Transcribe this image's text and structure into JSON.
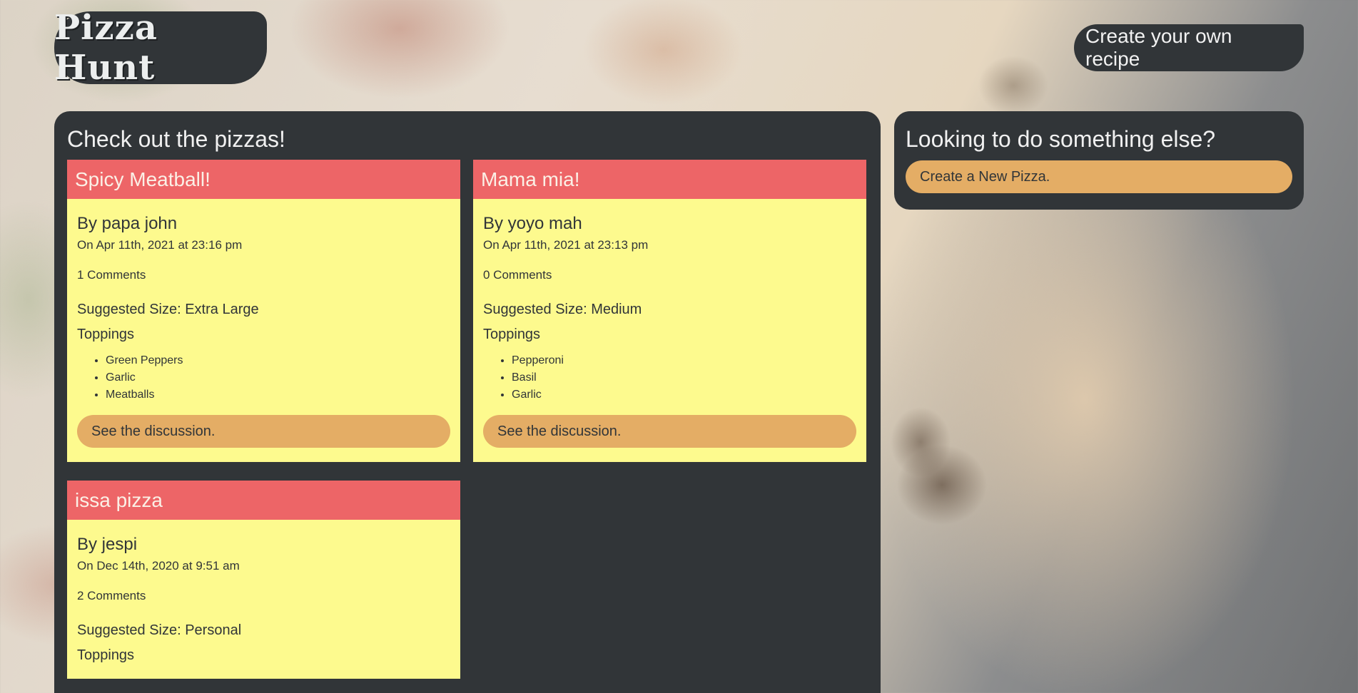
{
  "header": {
    "brand": "Pizza Hunt",
    "create_recipe_link": "Create your own recipe"
  },
  "main": {
    "heading": "Check out the pizzas!",
    "discussion_button_label": "See the discussion.",
    "toppings_label": "Toppings",
    "pizzas": [
      {
        "name": "Spicy Meatball!",
        "author": "By papa john",
        "date": "On Apr 11th, 2021 at 23:16 pm",
        "comments": "1 Comments",
        "size": "Suggested Size: Extra Large",
        "toppings": [
          "Green Peppers",
          "Garlic",
          "Meatballs"
        ]
      },
      {
        "name": "Mama mia!",
        "author": "By yoyo mah",
        "date": "On Apr 11th, 2021 at 23:13 pm",
        "comments": "0 Comments",
        "size": "Suggested Size: Medium",
        "toppings": [
          "Pepperoni",
          "Basil",
          "Garlic"
        ]
      },
      {
        "name": "issa pizza",
        "author": "By jespi",
        "date": "On Dec 14th, 2020 at 9:51 am",
        "comments": "2 Comments",
        "size": "Suggested Size: Personal",
        "toppings": []
      }
    ]
  },
  "sidebar": {
    "heading": "Looking to do something else?",
    "new_pizza_button": "Create a New Pizza."
  },
  "colors": {
    "panel": "#313538",
    "card_header": "#ed6567",
    "card_body": "#fdfa8e",
    "button": "#e4ad65"
  }
}
